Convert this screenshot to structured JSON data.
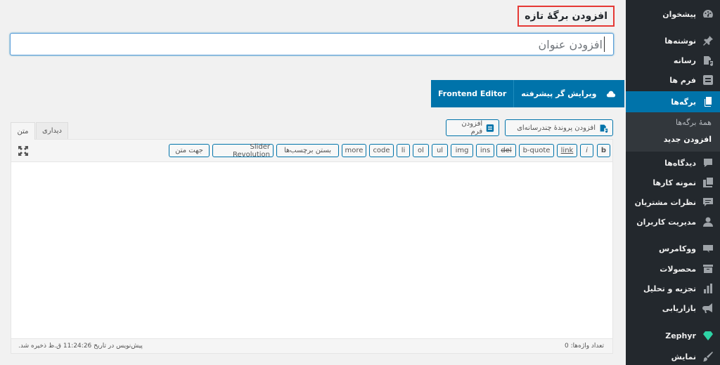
{
  "sidebar": {
    "items": [
      {
        "label": "پیشخوان",
        "icon": "dashboard-icon"
      },
      {
        "label": "نوشته‌ها",
        "icon": "pin-icon"
      },
      {
        "label": "رسانه",
        "icon": "media-icon"
      },
      {
        "label": "فرم ها",
        "icon": "form-icon"
      },
      {
        "label": "برگه‌ها",
        "icon": "pages-icon"
      },
      {
        "label": "دیدگاه‌ها",
        "icon": "comment-icon"
      },
      {
        "label": "نمونه کارها",
        "icon": "portfolio-icon"
      },
      {
        "label": "نظرات مشتریان",
        "icon": "testimonial-icon"
      },
      {
        "label": "مدیریت کاربران",
        "icon": "user-icon"
      },
      {
        "label": "ووکامرس",
        "icon": "woo-icon"
      },
      {
        "label": "محصولات",
        "icon": "archive-icon"
      },
      {
        "label": "تجزیه و تحلیل",
        "icon": "chart-bar-icon"
      },
      {
        "label": "بازاریابی",
        "icon": "megaphone-icon"
      },
      {
        "label": "Zephyr",
        "icon": "diamond-icon"
      },
      {
        "label": "نمایش",
        "icon": "brush-icon"
      }
    ],
    "submenu": {
      "all_pages": "همهٔ برگه‌ها",
      "add_new": "افزودن جدید"
    },
    "active_color": "#0073aa"
  },
  "header": {
    "title": "افزودن برگهٔ تازه"
  },
  "title_input": {
    "placeholder": "افزودن عنوان"
  },
  "builder": {
    "advanced_editor": "ویرایش گر پیشرفته",
    "frontend_editor": "Frontend Editor"
  },
  "media": {
    "add_media": "افزودن پروندهٔ چندرسانه‌ای",
    "add_form": "افزودن فرم"
  },
  "tabs": {
    "text": "متن",
    "visual": "دیداری"
  },
  "quicktags": [
    "b",
    "i",
    "link",
    "b-quote",
    "del",
    "ins",
    "img",
    "ul",
    "ol",
    "li",
    "code",
    "more",
    "بستن برچسب‌ها",
    "Slider Revolution",
    "جهت متن"
  ],
  "status": {
    "word_count": "تعداد واژه‌ها: 0",
    "draft_saved": "پیش‌نویس در تاریخ 11:24:26 ق.ظ ذخیره شد."
  }
}
